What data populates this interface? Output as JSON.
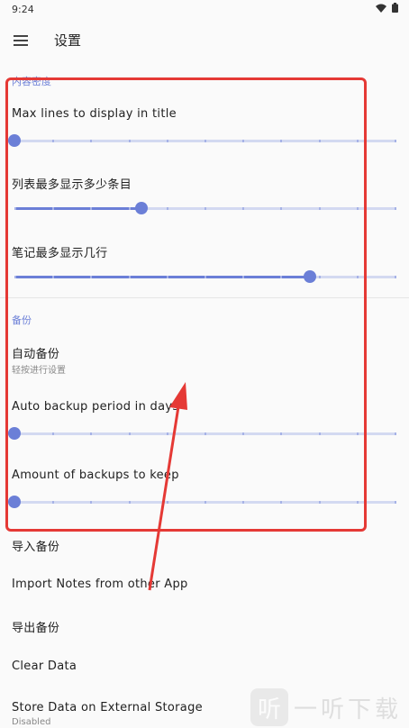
{
  "status_bar": {
    "time": "9:24"
  },
  "app_bar": {
    "title": "设置",
    "menu_icon": "hamburger-menu-icon"
  },
  "content_section": {
    "header": "内容密度"
  },
  "sliders_top": [
    {
      "label": "Max lines to display in title",
      "value_fraction": 0.0
    },
    {
      "label": "列表最多显示多少条目",
      "value_fraction": 0.333
    },
    {
      "label": "笔记最多显示几行",
      "value_fraction": 0.778
    }
  ],
  "backup_section": {
    "header": "备份"
  },
  "auto_backup": {
    "title": "自动备份",
    "subtitle": "轻按进行设置"
  },
  "sliders_backup": [
    {
      "label": "Auto backup period in days",
      "value_fraction": 0.0
    },
    {
      "label": "Amount of backups to keep",
      "value_fraction": 0.0
    }
  ],
  "items": [
    {
      "title": "导入备份"
    },
    {
      "title": "Import Notes from other App"
    },
    {
      "title": "导出备份"
    },
    {
      "title": "Clear Data"
    },
    {
      "title": "Store Data on External Storage",
      "subtitle": "Disabled"
    }
  ],
  "watermark": {
    "logo_char": "听",
    "text": "一听下载"
  },
  "colors": {
    "accent": "#6b7fd7",
    "highlight": "#e53935"
  }
}
